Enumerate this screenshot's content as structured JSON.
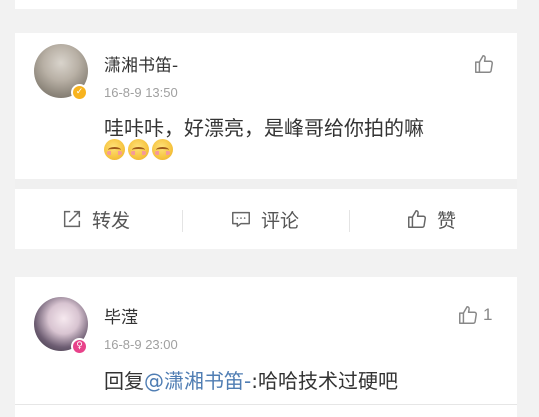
{
  "comments": [
    {
      "author": "潇湘书笛-",
      "time": "16-8-9 13:50",
      "text": "哇咔咔，好漂亮，是峰哥给你拍的嘛",
      "emoji_count": 3,
      "badge": "V",
      "like_count": ""
    },
    {
      "author": "毕滢",
      "time": "16-8-9 23:00",
      "reply_prefix": "回复",
      "mention": "@潇湘书笛-",
      "reply_text": ":哈哈技术过硬吧",
      "badge": "",
      "like_count": "1"
    }
  ],
  "actions": {
    "repost_label": "转发",
    "comment_label": "评论",
    "like_label": "赞"
  },
  "colors": {
    "accent_link": "#4f7db3",
    "badge_gold": "#f7b31f",
    "badge_pink": "#e8428a"
  },
  "icons": [
    "thumbs-up-icon",
    "repost-icon",
    "comment-icon",
    "verified-badge-icon"
  ]
}
